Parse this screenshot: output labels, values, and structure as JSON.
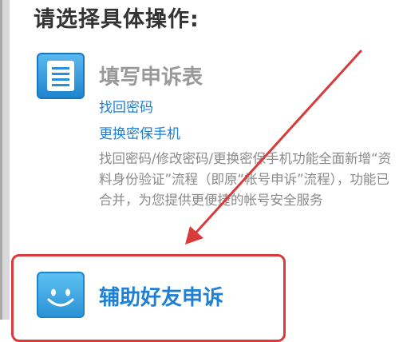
{
  "page_title": "请选择具体操作:",
  "items": [
    {
      "title": "填写申诉表",
      "icon": "form-document-icon",
      "links": [
        "找回密码",
        "更换密保手机"
      ],
      "description": "找回密码/修改密码/更换密保手机功能全面新增“资料身份验证”流程（即原“帐号申诉”流程），功能已合并，为您提供更便捷的帐号安全服务"
    },
    {
      "title": "辅助好友申诉",
      "icon": "smiley-face-icon"
    }
  ],
  "colors": {
    "link": "#1f7fd4",
    "annotation": "#d93a3a",
    "icon_blue": "#2b93d7",
    "muted_text": "#999999"
  }
}
